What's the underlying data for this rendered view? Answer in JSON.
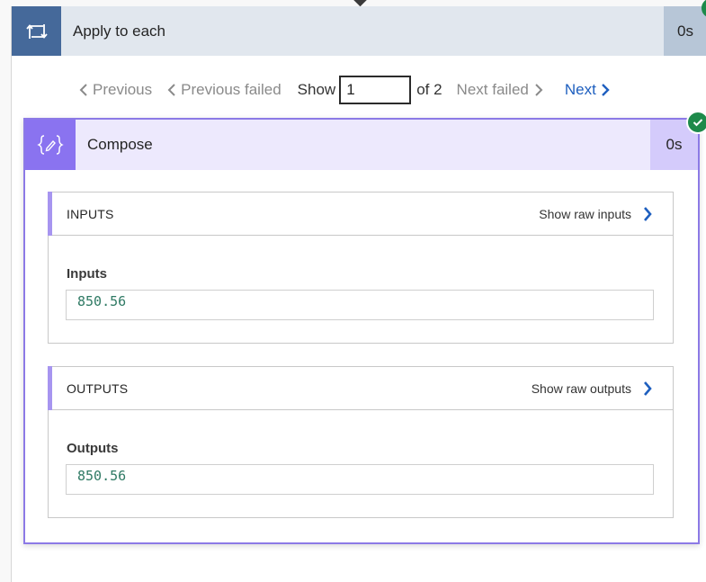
{
  "loop": {
    "title": "Apply to each",
    "duration": "0s",
    "icon": "loop-icon",
    "status": "succeeded"
  },
  "pager": {
    "previous": "Previous",
    "previous_failed": "Previous failed",
    "show_label": "Show",
    "current": "1",
    "of_label": "of 2",
    "next_failed": "Next failed",
    "next": "Next"
  },
  "compose": {
    "title": "Compose",
    "duration": "0s",
    "icon": "compose-icon",
    "status": "succeeded",
    "sections": {
      "inputs": {
        "header": "INPUTS",
        "raw_link": "Show raw inputs",
        "label": "Inputs",
        "value": "850.56"
      },
      "outputs": {
        "header": "OUTPUTS",
        "raw_link": "Show raw outputs",
        "label": "Outputs",
        "value": "850.56"
      }
    }
  },
  "colors": {
    "loop_accent": "#45699a",
    "compose_accent": "#8a73f0",
    "link_blue": "#1e5fbf",
    "success_green": "#1d8a4a",
    "value_text": "#2f7a64"
  }
}
